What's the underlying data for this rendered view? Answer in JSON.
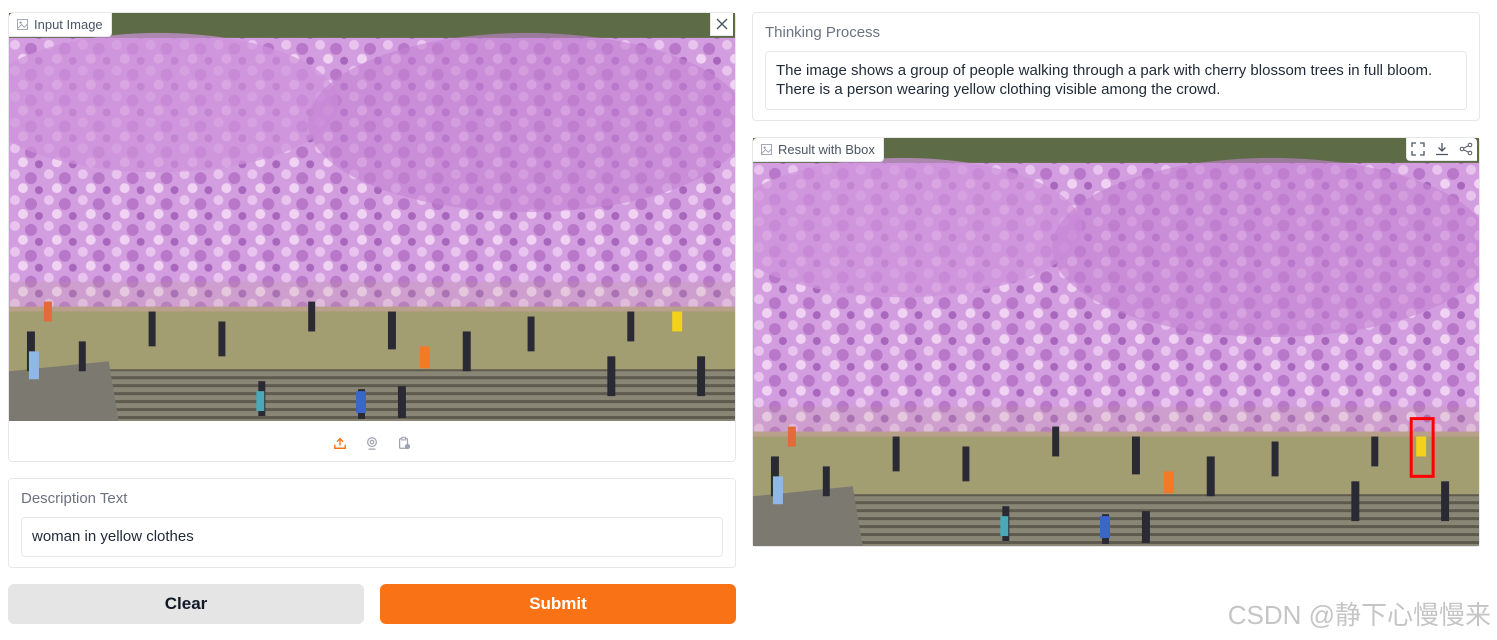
{
  "input_panel": {
    "label": "Input Image",
    "close_icon": "close-icon",
    "source_icons": [
      "upload-icon",
      "webcam-icon",
      "clipboard-icon"
    ],
    "active_color": "#f97316"
  },
  "description": {
    "label": "Description Text",
    "value": "woman in yellow clothes"
  },
  "buttons": {
    "clear_label": "Clear",
    "submit_label": "Submit",
    "submit_color": "#f97316",
    "clear_color": "#e5e5e5"
  },
  "thinking": {
    "label": "Thinking Process",
    "text": "The image shows a group of people walking through a park with cherry blossom trees in full bloom. There is a person wearing yellow clothing visible among the crowd."
  },
  "result_panel": {
    "label": "Result with Bbox",
    "toolbar_icons": [
      "fullscreen-icon",
      "download-icon",
      "share-icon"
    ],
    "bbox_color": "#ff0000"
  },
  "watermark": "CSDN @静下心慢慢来"
}
